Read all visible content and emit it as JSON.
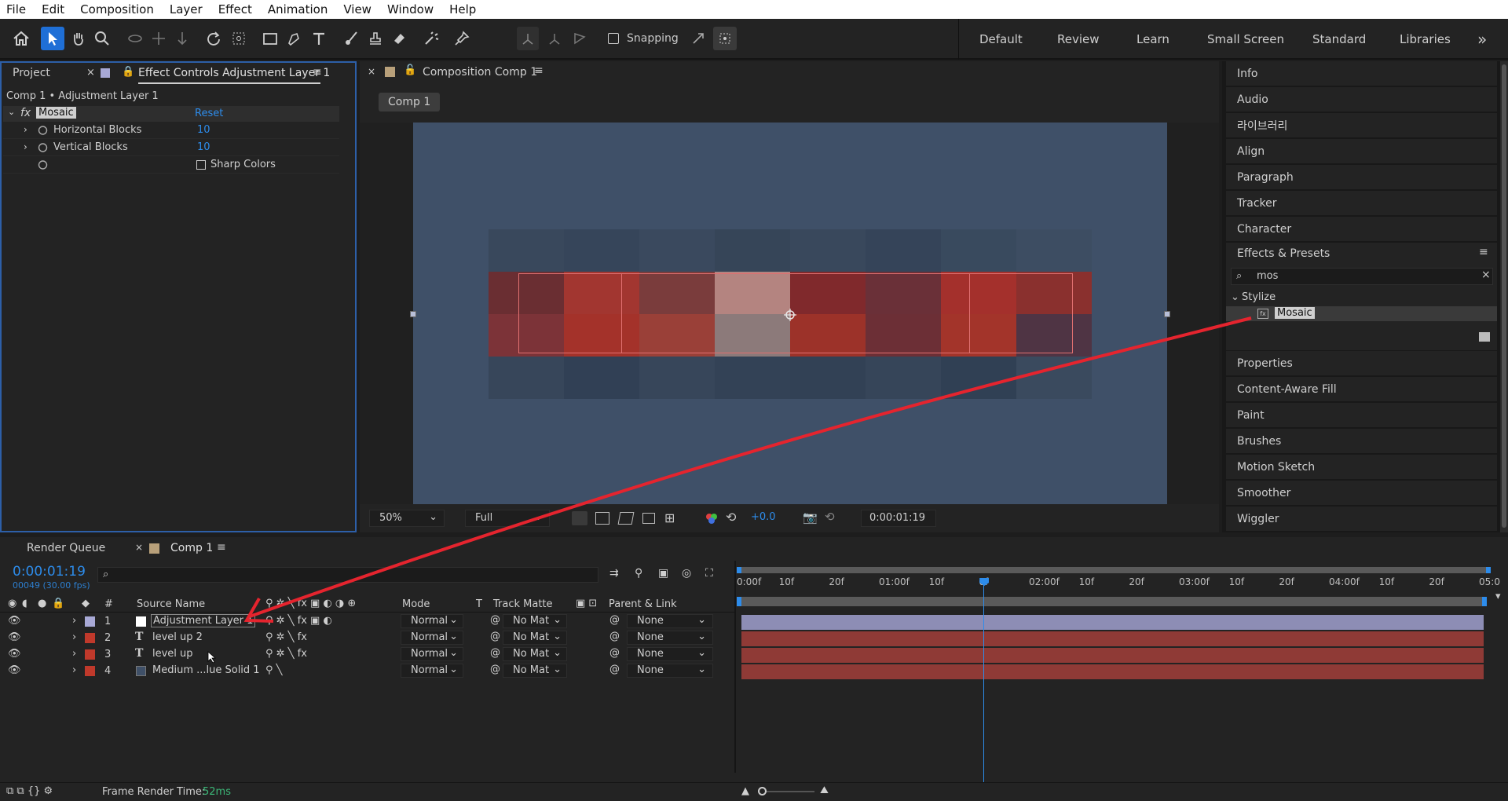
{
  "menu": [
    "File",
    "Edit",
    "Composition",
    "Layer",
    "Effect",
    "Animation",
    "View",
    "Window",
    "Help"
  ],
  "toolbar": {
    "snapping_label": "Snapping"
  },
  "workspaces": [
    "Default",
    "Review",
    "Learn",
    "Small Screen",
    "Standard",
    "Libraries"
  ],
  "workspace_more": "»",
  "left_panel": {
    "tab_project": "Project",
    "tab_effect_controls": "Effect Controls Adjustment Layer 1",
    "breadcrumb": "Comp 1 • Adjustment Layer 1",
    "effect": {
      "fx_label": "fx",
      "name": "Mosaic",
      "reset": "Reset",
      "params": [
        {
          "label": "Horizontal Blocks",
          "value": "10"
        },
        {
          "label": "Vertical Blocks",
          "value": "10"
        }
      ],
      "checkbox_label": "Sharp Colors"
    }
  },
  "composition": {
    "tab_label": "Composition Comp 1",
    "subtab": "Comp 1",
    "zoom": "50%",
    "resolution": "Full",
    "exposure": "+0.0",
    "timecode": "0:00:01:19"
  },
  "right_panel": {
    "items_top": [
      "Info",
      "Audio",
      "라이브러리",
      "Align",
      "Paragraph",
      "Tracker",
      "Character"
    ],
    "effects_presets": "Effects & Presets",
    "search_value": "mos",
    "category": "Stylize",
    "result": "Mosaic",
    "items_bottom": [
      "Properties",
      "Content-Aware Fill",
      "Paint",
      "Brushes",
      "Motion Sketch",
      "Smoother",
      "Wiggler"
    ]
  },
  "timeline": {
    "tab_render_queue": "Render Queue",
    "tab_comp": "Comp 1",
    "current_time": "0:00:01:19",
    "fps_info": "00049 (30.00 fps)",
    "columns": {
      "source_name": "Source Name",
      "mode": "Mode",
      "t": "T",
      "track_matte": "Track Matte",
      "parent": "Parent & Link",
      "num": "#"
    },
    "layers": [
      {
        "num": "1",
        "name": "Adjustment Layer 1",
        "mode": "Normal",
        "matte": "No Mat",
        "parent": "None",
        "label_color": "#a8a9d6"
      },
      {
        "num": "2",
        "name": "level up 2",
        "mode": "Normal",
        "matte": "No Mat",
        "parent": "None",
        "label_color": "#c0392b"
      },
      {
        "num": "3",
        "name": "level up",
        "mode": "Normal",
        "matte": "No Mat",
        "parent": "None",
        "label_color": "#c0392b"
      },
      {
        "num": "4",
        "name": "Medium ...lue Solid 1",
        "mode": "Normal",
        "matte": "No Mat",
        "parent": "None",
        "label_color": "#c0392b"
      }
    ],
    "ruler": [
      "0:00f",
      "10f",
      "20f",
      "01:00f",
      "10f",
      "0f",
      "02:00f",
      "10f",
      "20f",
      "03:00f",
      "10f",
      "20f",
      "04:00f",
      "10f",
      "20f",
      "05:0"
    ],
    "playhead_fraction": 0.33
  },
  "status": {
    "frame_render_label": "Frame Render Time:",
    "frame_render_value": "52ms"
  },
  "colors": {
    "accent_blue": "#2d8ceb",
    "comp_bg": "#3f5068",
    "layer_bar_red": "#8f3a36",
    "adjustment_bar": "#8d8db5",
    "arrow_red": "#e5242e"
  }
}
